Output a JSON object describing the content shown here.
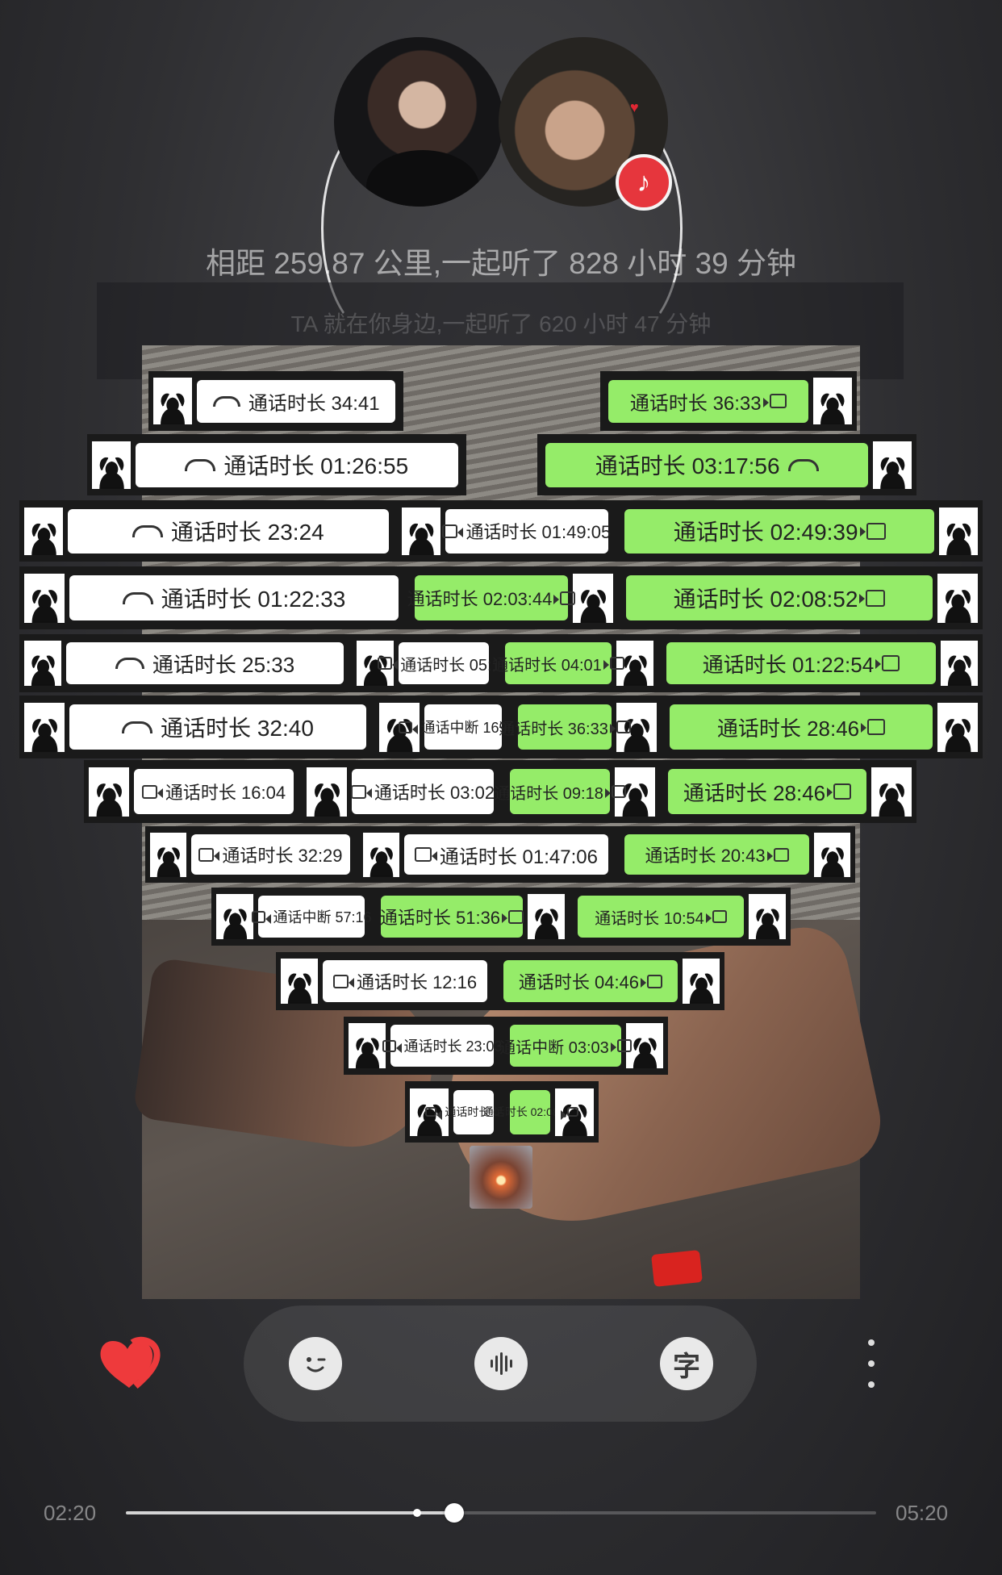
{
  "header": {
    "distance_text": "相距 259.87 公里,一起听了 828 小时 39 分钟",
    "subline_text": "TA 就在你身边,一起听了 620 小时 47 分钟"
  },
  "colors": {
    "bubble_green": "#95ec69",
    "bubble_white": "#ffffff",
    "accent_red": "#e6363d"
  },
  "call_records": [
    {
      "label": "通话时长 34:41",
      "icon": "phone-icon",
      "style": "white"
    },
    {
      "label": "通话时长 36:33",
      "icon": "video-icon",
      "style": "green"
    },
    {
      "label": "通话时长 01:26:55",
      "icon": "phone-icon",
      "style": "white"
    },
    {
      "label": "通话时长 03:17:56",
      "icon": "phone-icon",
      "style": "green"
    },
    {
      "label": "通话时长 23:24",
      "icon": "phone-icon",
      "style": "white"
    },
    {
      "label": "通话时长 01:49:05",
      "icon": "video-icon",
      "style": "white"
    },
    {
      "label": "通话时长 02:49:39",
      "icon": "video-icon",
      "style": "green"
    },
    {
      "label": "通话时长 01:22:33",
      "icon": "phone-icon",
      "style": "white"
    },
    {
      "label": "通话时长 02:03:44",
      "icon": "video-icon",
      "style": "green"
    },
    {
      "label": "通话时长 02:08:52",
      "icon": "video-icon",
      "style": "green"
    },
    {
      "label": "通话时长 25:33",
      "icon": "phone-icon",
      "style": "white"
    },
    {
      "label": "通话时长 05:18",
      "icon": "video-icon",
      "style": "white"
    },
    {
      "label": "通话时长 04:01",
      "icon": "video-icon",
      "style": "green"
    },
    {
      "label": "通话时长 01:22:54",
      "icon": "video-icon",
      "style": "green"
    },
    {
      "label": "通话时长 32:40",
      "icon": "phone-icon",
      "style": "white"
    },
    {
      "label": "通话中断 169:58",
      "icon": "video-icon",
      "style": "white"
    },
    {
      "label": "通话时长 36:33",
      "icon": "video-icon",
      "style": "green"
    },
    {
      "label": "通话时长 28:46",
      "icon": "video-icon",
      "style": "green"
    },
    {
      "label": "通话时长 16:04",
      "icon": "video-icon",
      "style": "white"
    },
    {
      "label": "通话时长 03:02",
      "icon": "video-icon",
      "style": "white"
    },
    {
      "label": "通话时长 09:18",
      "icon": "video-icon",
      "style": "green"
    },
    {
      "label": "通话时长 28:46",
      "icon": "video-icon",
      "style": "green"
    },
    {
      "label": "通话时长 32:29",
      "icon": "video-icon",
      "style": "white"
    },
    {
      "label": "通话时长 01:47:06",
      "icon": "video-icon",
      "style": "white"
    },
    {
      "label": "通话时长 20:43",
      "icon": "video-icon",
      "style": "green"
    },
    {
      "label": "通话中断 57:16",
      "icon": "video-icon",
      "style": "white"
    },
    {
      "label": "通话时长 51:36",
      "icon": "video-icon",
      "style": "green"
    },
    {
      "label": "通话时长 10:54",
      "icon": "video-icon",
      "style": "green"
    },
    {
      "label": "通话时长 12:16",
      "icon": "video-icon",
      "style": "white"
    },
    {
      "label": "通话时长 04:46",
      "icon": "video-icon",
      "style": "green"
    },
    {
      "label": "通话时长 23:03",
      "icon": "video-icon",
      "style": "white"
    },
    {
      "label": "通话中断 03:03",
      "icon": "video-icon",
      "style": "green"
    },
    {
      "label": "通话时长 07:40",
      "icon": "video-icon",
      "style": "white"
    },
    {
      "label": "通话时长 02:08",
      "icon": "video-icon",
      "style": "green"
    }
  ],
  "controls": {
    "like_icon": "heart-icon",
    "effect_icon": "wink-face-icon",
    "audio_icon": "sound-wave-icon",
    "lyrics_label": "字",
    "more_icon": "more-vertical-icon"
  },
  "player": {
    "current_time": "02:20",
    "total_time": "05:20",
    "progress": 0.4375
  }
}
